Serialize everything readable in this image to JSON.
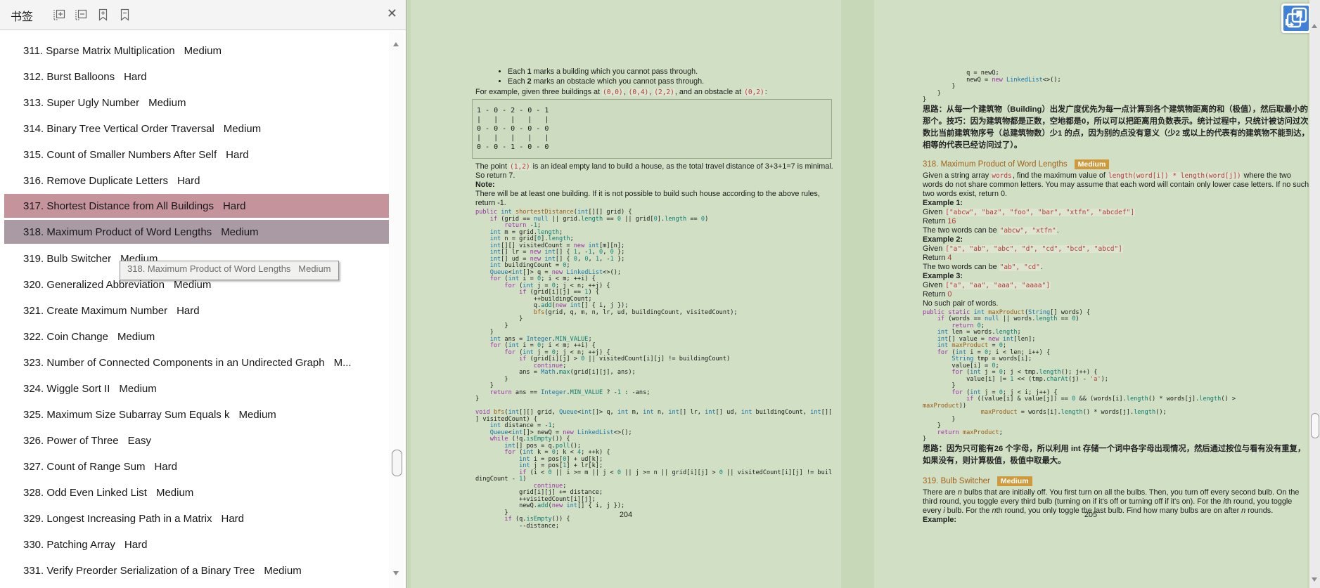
{
  "panel": {
    "title": "书签",
    "icons": [
      "expand-all-icon",
      "collapse-all-icon",
      "add-bookmark-icon",
      "delete-bookmark-icon",
      "close-icon"
    ],
    "tooltip": "318. Maximum Product of Word Lengths   Medium",
    "items": [
      {
        "label": "311. Sparse Matrix Multiplication",
        "difficulty": "Medium",
        "highlight": null
      },
      {
        "label": "312. Burst Balloons",
        "difficulty": "Hard",
        "highlight": null
      },
      {
        "label": "313. Super Ugly Number",
        "difficulty": "Medium",
        "highlight": null
      },
      {
        "label": "314. Binary Tree Vertical Order Traversal",
        "difficulty": "Medium",
        "highlight": null
      },
      {
        "label": "315. Count of Smaller Numbers After Self",
        "difficulty": "Hard",
        "highlight": null
      },
      {
        "label": "316. Remove Duplicate Letters",
        "difficulty": "Hard",
        "highlight": null
      },
      {
        "label": "317. Shortest Distance from All Buildings",
        "difficulty": "Hard",
        "highlight": "red"
      },
      {
        "label": "318. Maximum Product of Word Lengths",
        "difficulty": "Medium",
        "highlight": "purple"
      },
      {
        "label": "319. Bulb Switcher",
        "difficulty": "Medium",
        "highlight": null
      },
      {
        "label": "320. Generalized Abbreviation",
        "difficulty": "Medium",
        "highlight": null
      },
      {
        "label": "321. Create Maximum Number",
        "difficulty": "Hard",
        "highlight": null
      },
      {
        "label": "322. Coin Change",
        "difficulty": "Medium",
        "highlight": null
      },
      {
        "label": "323. Number of Connected Components in an Undirected Graph",
        "difficulty": "M...",
        "highlight": null
      },
      {
        "label": "324. Wiggle Sort II",
        "difficulty": "Medium",
        "highlight": null
      },
      {
        "label": "325. Maximum Size Subarray Sum Equals k",
        "difficulty": "Medium",
        "highlight": null
      },
      {
        "label": "326. Power of Three",
        "difficulty": "Easy",
        "highlight": null
      },
      {
        "label": "327. Count of Range Sum",
        "difficulty": "Hard",
        "highlight": null
      },
      {
        "label": "328. Odd Even Linked List",
        "difficulty": "Medium",
        "highlight": null
      },
      {
        "label": "329. Longest Increasing Path in a Matrix",
        "difficulty": "Hard",
        "highlight": null
      },
      {
        "label": "330. Patching Array",
        "difficulty": "Hard",
        "highlight": null
      },
      {
        "label": "331. Verify Preorder Serialization of a Binary Tree",
        "difficulty": "Medium",
        "highlight": null
      }
    ]
  },
  "colors": {
    "highlight_red": "#c4939c",
    "highlight_purple": "#a99aa4",
    "badge_orange": "#cf9a3c",
    "float_button_blue": "#3f81d8",
    "code_red": "#b13c3c",
    "page_green": "#d1e0c5",
    "canvas_green": "#c7d8b9"
  },
  "pages": {
    "left": {
      "number": "204",
      "blocks": [
        {
          "type": "bullets",
          "items": [
            [
              [
                "t",
                "Each "
              ],
              [
                "b",
                "1"
              ],
              [
                "t",
                " marks a building which you cannot pass through."
              ]
            ],
            [
              [
                "t",
                "Each "
              ],
              [
                "b",
                "2"
              ],
              [
                "t",
                " marks an obstacle which you cannot pass through."
              ]
            ]
          ]
        },
        {
          "type": "p",
          "segs": [
            [
              "t",
              "For example, given three buildings at "
            ],
            [
              "r",
              "(0,0)"
            ],
            [
              "t",
              ", "
            ],
            [
              "r",
              "(0,4)"
            ],
            [
              "t",
              ", "
            ],
            [
              "r",
              "(2,2)"
            ],
            [
              "t",
              ", and an obstacle at "
            ],
            [
              "r",
              "(0,2)"
            ],
            [
              "t",
              ":"
            ]
          ]
        },
        {
          "type": "box",
          "lines": [
            "1 - 0 - 2 - 0 - 1",
            "|   |   |   |   |",
            "0 - 0 - 0 - 0 - 0",
            "|   |   |   |   |",
            "0 - 0 - 1 - 0 - 0"
          ]
        },
        {
          "type": "p",
          "segs": [
            [
              "t",
              "The point "
            ],
            [
              "r",
              "(1,2)"
            ],
            [
              "t",
              " is an ideal empty land to build a house, as the total travel distance of 3+3+1=7 is minimal. So return 7."
            ]
          ]
        },
        {
          "type": "p",
          "segs": [
            [
              "b",
              "Note:"
            ]
          ]
        },
        {
          "type": "p",
          "segs": [
            [
              "t",
              "There will be at least one building. If it is not possible to build such house according to the above rules, return -1."
            ]
          ]
        },
        {
          "type": "java",
          "lines": [
            "public int shortestDistance(int[][] grid) {",
            "    if (grid == null || grid.length == 0 || grid[0].length == 0)",
            "        return -1;",
            "    int m = grid.length;",
            "    int n = grid[0].length;",
            "    int[][] visitedCount = new int[m][n];",
            "    int[] lr = new int[] { 1, -1, 0, 0 };",
            "    int[] ud = new int[] { 0, 0, 1, -1 };",
            "    int buildingCount = 0;",
            "    Queue<int[]> q = new LinkedList<>();",
            "    for (int i = 0; i < m; ++i) {",
            "        for (int j = 0; j < n; ++j) {",
            "            if (grid[i][j] == 1) {",
            "                ++buildingCount;",
            "                q.add(new int[] { i, j });",
            "                bfs(grid, q, m, n, lr, ud, buildingCount, visitedCount);",
            "            }",
            "        }",
            "    }",
            "    int ans = Integer.MIN_VALUE;",
            "    for (int i = 0; i < m; ++i) {",
            "        for (int j = 0; j < n; ++j) {",
            "            if (grid[i][j] > 0 || visitedCount[i][j] != buildingCount)",
            "                continue;",
            "            ans = Math.max(grid[i][j], ans);",
            "        }",
            "    }",
            "    return ans == Integer.MIN_VALUE ? -1 : -ans;",
            "}",
            "",
            "void bfs(int[][] grid, Queue<int[]> q, int m, int n, int[] lr, int[] ud, int buildingCount, int[][",
            "] visitedCount) {",
            "    int distance = -1;",
            "    Queue<int[]> newQ = new LinkedList<>();",
            "    while (!q.isEmpty()) {",
            "        int[] pos = q.poll();",
            "        for (int k = 0; k < 4; ++k) {",
            "            int i = pos[0] + ud[k];",
            "            int j = pos[1] + lr[k];",
            "            if (i < 0 || i >= m || j < 0 || j >= n || grid[i][j] > 0 || visitedCount[i][j] != buil",
            "dingCount - 1)",
            "                continue;",
            "            grid[i][j] += distance;",
            "            ++visitedCount[i][j];",
            "            newQ.add(new int[] { i, j });",
            "        }",
            "        if (q.isEmpty()) {",
            "            --distance;"
          ]
        }
      ]
    },
    "right": {
      "number": "205",
      "blocks": [
        {
          "type": "java",
          "lines": [
            "            q = newQ;",
            "            newQ = new LinkedList<>();",
            "        }",
            "    }",
            "}"
          ]
        },
        {
          "type": "p",
          "cls": "think",
          "segs": [
            [
              "t",
              "思路：从每一个建筑物（Building）出发广度优先为每一点计算到各个建筑物距离的和（极值），然后取最小的那个。技巧：因为建筑物都是正数，空地都是0，所以可以把距离用负数表示。统计过程中，只统计被访问过次数比当前建筑物序号（总建筑物数）少1 的点，因为别的点没有意义（少2 或以上的代表有的建筑物不能到达，相等的代表已经访问过了）。"
            ]
          ]
        },
        {
          "type": "gap",
          "h": 8
        },
        {
          "type": "h",
          "num": "318.",
          "title": "Maximum Product of Word Lengths",
          "badge": "Medium"
        },
        {
          "type": "p",
          "segs": [
            [
              "t",
              "Given a string array "
            ],
            [
              "r",
              "words"
            ],
            [
              "t",
              ", find the maximum value of "
            ],
            [
              "r",
              "length(word[i]) * length(word[j])"
            ],
            [
              "t",
              " where the two words do not share common letters. You may assume that each word will contain only lower case letters. If no such two words exist, return 0."
            ]
          ]
        },
        {
          "type": "p",
          "segs": [
            [
              "b",
              "Example 1:"
            ]
          ]
        },
        {
          "type": "p",
          "segs": [
            [
              "t",
              "Given "
            ],
            [
              "r",
              "[\"abcw\", \"baz\", \"foo\", \"bar\", \"xtfn\", \"abcdef\"]"
            ]
          ]
        },
        {
          "type": "p",
          "segs": [
            [
              "t",
              "Return "
            ],
            [
              "n",
              "16"
            ]
          ]
        },
        {
          "type": "p",
          "segs": [
            [
              "t",
              "The two words can be "
            ],
            [
              "r",
              "\"abcw\", \"xtfn\""
            ],
            [
              "t",
              "."
            ]
          ]
        },
        {
          "type": "p",
          "segs": [
            [
              "b",
              "Example 2:"
            ]
          ]
        },
        {
          "type": "p",
          "segs": [
            [
              "t",
              "Given "
            ],
            [
              "r",
              "[\"a\", \"ab\", \"abc\", \"d\", \"cd\", \"bcd\", \"abcd\"]"
            ]
          ]
        },
        {
          "type": "p",
          "segs": [
            [
              "t",
              "Return "
            ],
            [
              "n",
              "4"
            ]
          ]
        },
        {
          "type": "p",
          "segs": [
            [
              "t",
              "The two words can be "
            ],
            [
              "r",
              "\"ab\", \"cd\""
            ],
            [
              "t",
              "."
            ]
          ]
        },
        {
          "type": "p",
          "segs": [
            [
              "b",
              "Example 3:"
            ]
          ]
        },
        {
          "type": "p",
          "segs": [
            [
              "t",
              "Given "
            ],
            [
              "r",
              "[\"a\", \"aa\", \"aaa\", \"aaaa\"]"
            ]
          ]
        },
        {
          "type": "p",
          "segs": [
            [
              "t",
              "Return "
            ],
            [
              "n",
              "0"
            ]
          ]
        },
        {
          "type": "p",
          "segs": [
            [
              "t",
              "No such pair of words."
            ]
          ]
        },
        {
          "type": "java",
          "lines": [
            "public static int maxProduct(String[] words) {",
            "    if (words == null || words.length == 0)",
            "        return 0;",
            "    int len = words.length;",
            "    int[] value = new int[len];",
            "    int maxProduct = 0;",
            "    for (int i = 0; i < len; i++) {",
            "        String tmp = words[i];",
            "        value[i] = 0;",
            "        for (int j = 0; j < tmp.length(); j++) {",
            "            value[i] |= 1 << (tmp.charAt(j) - 'a');",
            "        }",
            "        for (int j = 0; j < i; j++) {",
            "            if ((value[i] & value[j]) == 0 && (words[i].length() * words[j].length() >",
            "maxProduct))",
            "                maxProduct = words[i].length() * words[j].length();",
            "        }",
            "    }",
            "    return maxProduct;",
            "}"
          ]
        },
        {
          "type": "p",
          "cls": "think",
          "segs": [
            [
              "t",
              "思路：因为只可能有26 个字母，所以利用 int 存储一个词中各字母出现情况，然后通过按位与看有没有重复，如果没有，则计算极值，极值中取最大。"
            ]
          ]
        },
        {
          "type": "gap",
          "h": 10
        },
        {
          "type": "h",
          "num": "319.",
          "title": "Bulb Switcher",
          "badge": "Medium"
        },
        {
          "type": "p",
          "segs": [
            [
              "t",
              "There are "
            ],
            [
              "i",
              "n"
            ],
            [
              "t",
              " bulbs that are initially off. You first turn on all the bulbs. Then, you turn off every second bulb. On the third round, you toggle every third bulb (turning on if it's off or turning off if it's on). For the "
            ],
            [
              "i",
              "i"
            ],
            [
              "t",
              "th round, you toggle every "
            ],
            [
              "i",
              "i"
            ],
            [
              "t",
              " bulb. For the "
            ],
            [
              "i",
              "n"
            ],
            [
              "t",
              "th round, you only toggle the last bulb. Find how many bulbs are on after "
            ],
            [
              "i",
              "n"
            ],
            [
              "t",
              " rounds."
            ]
          ]
        },
        {
          "type": "p",
          "segs": [
            [
              "b",
              "Example:"
            ]
          ]
        }
      ]
    }
  }
}
